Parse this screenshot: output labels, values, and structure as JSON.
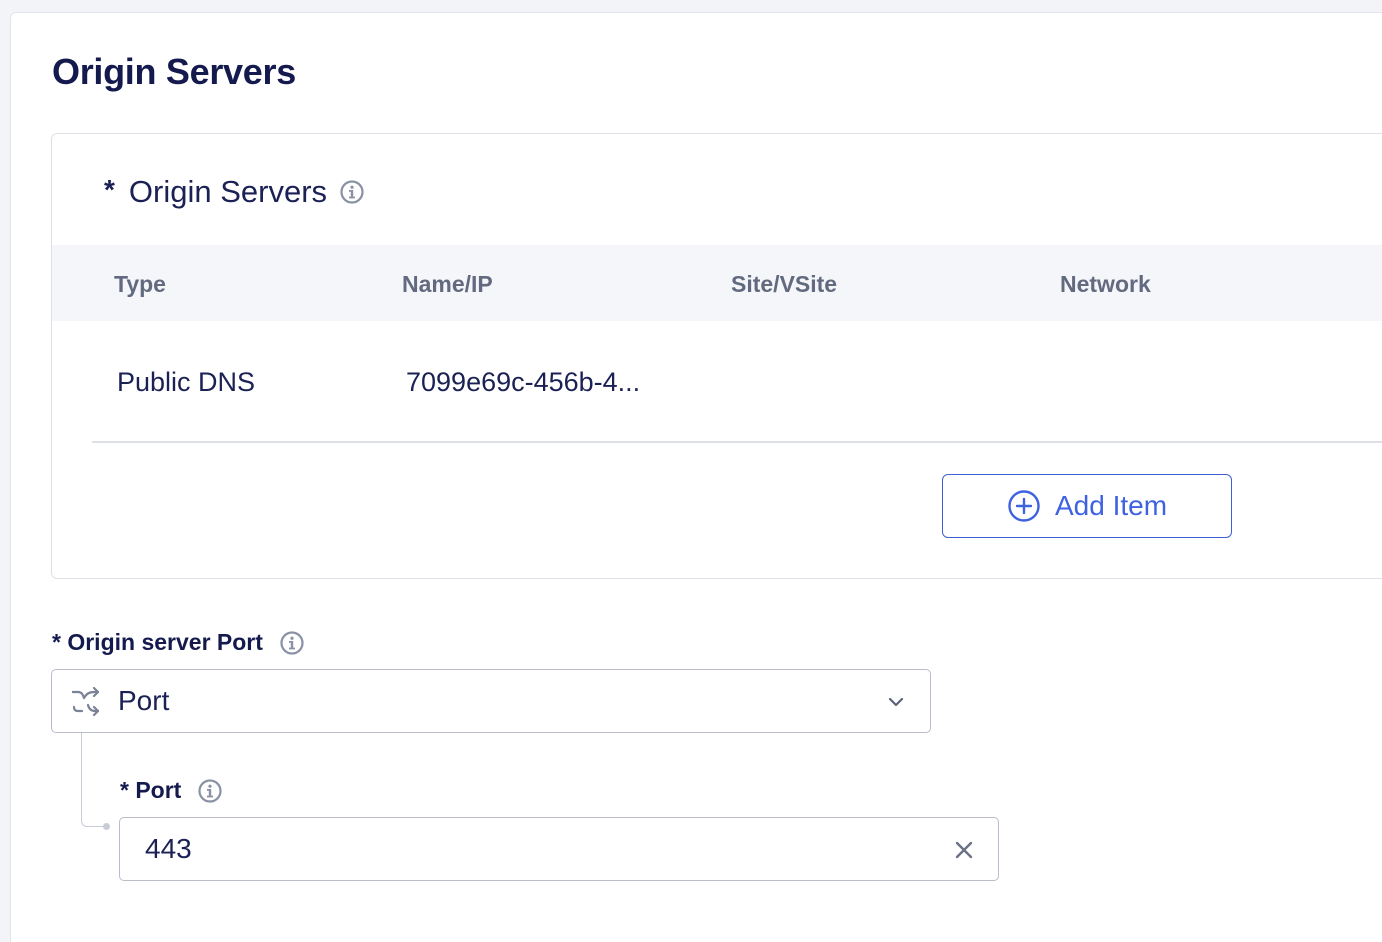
{
  "page": {
    "title": "Origin Servers"
  },
  "origin_servers": {
    "required_marker": "*",
    "title": "Origin Servers",
    "columns": [
      "Type",
      "Name/IP",
      "Site/VSite",
      "Network"
    ],
    "rows": [
      {
        "type": "Public DNS",
        "name_ip": "7099e69c-456b-4...",
        "site": "",
        "network": ""
      }
    ],
    "add_button_label": "Add Item"
  },
  "origin_port": {
    "label": "* Origin server Port",
    "selected": "Port",
    "sub_field": {
      "label": "* Port",
      "value": "443"
    }
  },
  "colors": {
    "primary": "#3f62e0",
    "heading": "#141a4d",
    "muted": "#626a80"
  },
  "icons": [
    "info-icon",
    "plus-circle-icon",
    "shuffle-icon",
    "chevron-down-icon",
    "close-icon"
  ]
}
